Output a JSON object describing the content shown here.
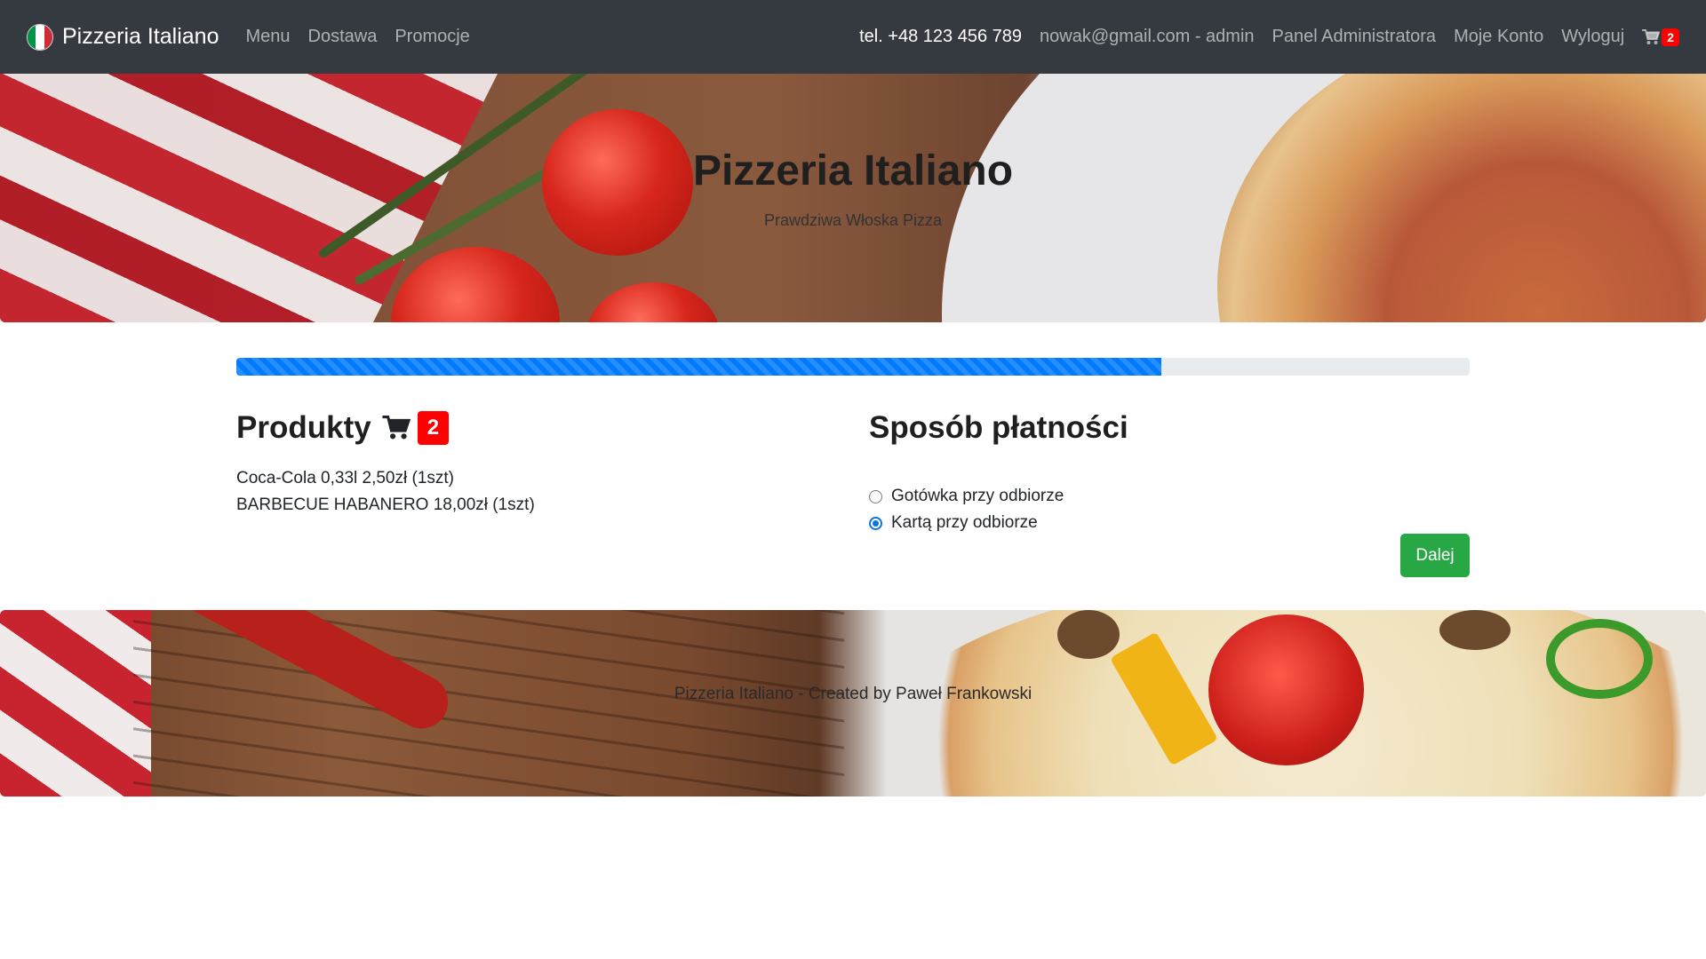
{
  "navbar": {
    "brand": "Pizzeria Italiano",
    "links": [
      "Menu",
      "Dostawa",
      "Promocje"
    ],
    "phone": "tel. +48 123 456 789",
    "user_email": "nowak@gmail.com - admin",
    "admin_panel": "Panel Administratora",
    "account": "Moje Konto",
    "logout": "Wyloguj",
    "cart_count": "2",
    "cart_icon": "shopping-cart-icon",
    "flag_colors": [
      "#009246",
      "#ffffff",
      "#ce2b37"
    ]
  },
  "hero": {
    "title": "Pizzeria Italiano",
    "subtitle": "Prawdziwa Włoska Pizza"
  },
  "progress": {
    "value_percent": 75,
    "color": "#007bff"
  },
  "products": {
    "heading": "Produkty",
    "count": "2",
    "items": [
      "Coca-Cola 0,33l 2,50zł (1szt)",
      "BARBECUE HABANERO 18,00zł (1szt)"
    ]
  },
  "payment": {
    "heading": "Sposób płatności",
    "options": [
      {
        "label": "Gotówka przy odbiorze",
        "checked": false
      },
      {
        "label": "Kartą przy odbiorze",
        "checked": true
      }
    ],
    "next_button": "Dalej",
    "accent_color": "#28a745"
  },
  "footer": {
    "text": "Pizzeria Italiano - Created by Paweł Frankowski"
  }
}
